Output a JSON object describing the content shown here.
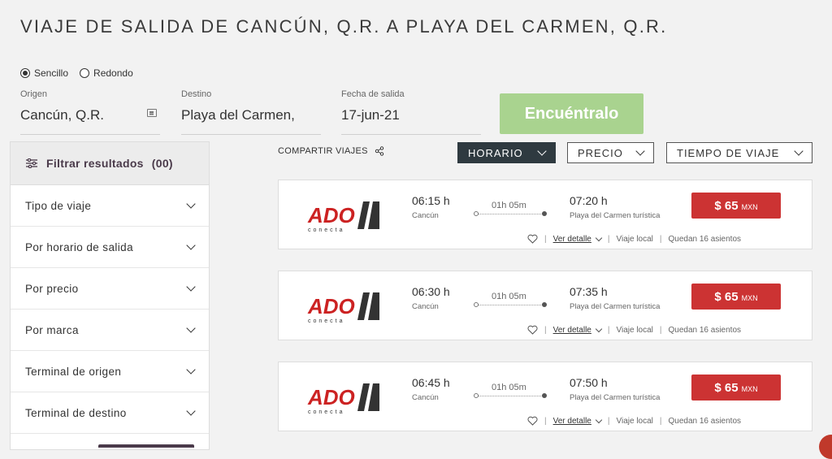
{
  "page_title": "VIAJE DE SALIDA DE CANCÚN, Q.R. A PLAYA DEL CARMEN, Q.R.",
  "trip_type": {
    "options": [
      {
        "label": "Sencillo",
        "selected": true
      },
      {
        "label": "Redondo",
        "selected": false
      }
    ]
  },
  "search": {
    "origin_label": "Origen",
    "origin_value": "Cancún, Q.R.",
    "destination_label": "Destino",
    "destination_value": "Playa del Carmen,",
    "date_label": "Fecha de salida",
    "date_value": "17-jun-21",
    "button": "Encuéntralo"
  },
  "filters": {
    "title": "Filtrar resultados",
    "count": "(00)",
    "items": [
      "Tipo de viaje",
      "Por horario de salida",
      "Por precio",
      "Por marca",
      "Terminal de origen",
      "Terminal de destino"
    ]
  },
  "share_label": "COMPARTIR VIAJES",
  "sort": {
    "options": [
      {
        "label": "HORARIO",
        "active": true
      },
      {
        "label": "PRECIO",
        "active": false
      },
      {
        "label": "TIEMPO DE VIAJE",
        "active": false
      }
    ]
  },
  "results": [
    {
      "brand": "ADO",
      "brand_sub": "conecta",
      "departure_time": "06:15 h",
      "departure_terminal": "Cancún",
      "duration": "01h 05m",
      "arrival_time": "07:20 h",
      "arrival_terminal": "Playa del Carmen turística",
      "price": "$ 65",
      "currency": "MXN",
      "detail_label": "Ver detalle",
      "service": "Viaje local",
      "seats": "Quedan 16 asientos"
    },
    {
      "brand": "ADO",
      "brand_sub": "conecta",
      "departure_time": "06:30 h",
      "departure_terminal": "Cancún",
      "duration": "01h 05m",
      "arrival_time": "07:35 h",
      "arrival_terminal": "Playa del Carmen turística",
      "price": "$ 65",
      "currency": "MXN",
      "detail_label": "Ver detalle",
      "service": "Viaje local",
      "seats": "Quedan 16 asientos"
    },
    {
      "brand": "ADO",
      "brand_sub": "conecta",
      "departure_time": "06:45 h",
      "departure_terminal": "Cancún",
      "duration": "01h 05m",
      "arrival_time": "07:50 h",
      "arrival_terminal": "Playa del Carmen turística",
      "price": "$ 65",
      "currency": "MXN",
      "detail_label": "Ver detalle",
      "service": "Viaje local",
      "seats": "Quedan 16 asientos"
    }
  ],
  "colors": {
    "accent": "#a9d38f",
    "price": "#cc3333",
    "sort_active": "#2f3a40",
    "brand": "#cc2222"
  },
  "icons": {
    "share": "share-icon",
    "filter": "sliders-icon",
    "calendar": "calendar-icon",
    "favorite": "heart-icon"
  }
}
